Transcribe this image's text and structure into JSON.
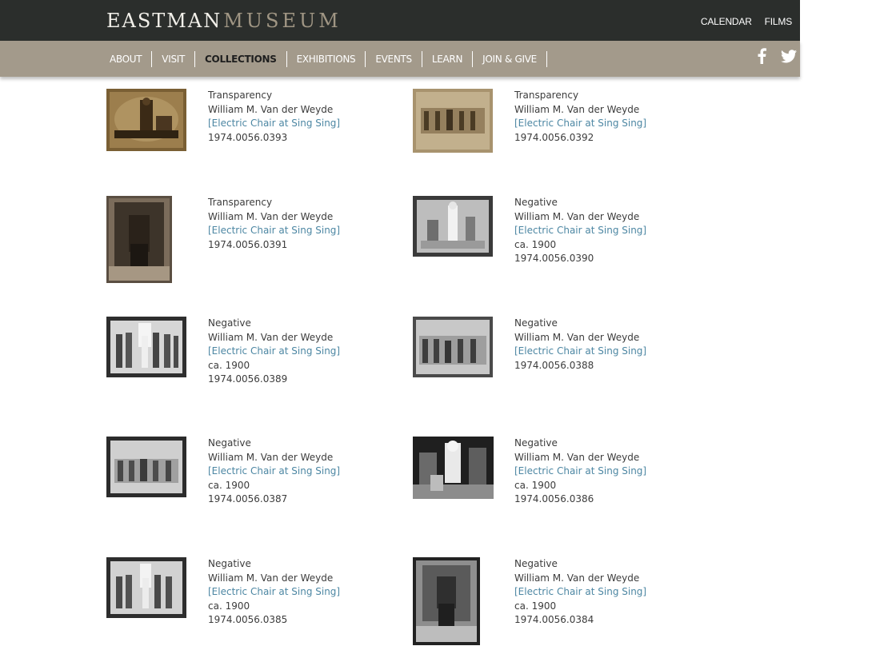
{
  "header": {
    "logo_part1": "EASTMAN",
    "logo_part2": "MUSEUM",
    "utility_links": [
      "CALENDAR",
      "FILMS"
    ]
  },
  "nav": {
    "items": [
      "ABOUT",
      "VISIT",
      "COLLECTIONS",
      "EXHIBITIONS",
      "EVENTS",
      "LEARN",
      "JOIN & GIVE"
    ],
    "active": "COLLECTIONS"
  },
  "social": [
    "facebook-icon",
    "twitter-icon"
  ],
  "colors": {
    "topbar": "#2b2e2c",
    "navbar": "#a39a8b",
    "link": "#4d87a3",
    "text": "#3c3c3c"
  },
  "results": [
    {
      "type": "Transparency",
      "artist": "William M. Van der Weyde",
      "title": "[Electric Chair at Sing Sing]",
      "date": "",
      "accession": "1974.0056.0393"
    },
    {
      "type": "Transparency",
      "artist": "William M. Van der Weyde",
      "title": "[Electric Chair at Sing Sing]",
      "date": "",
      "accession": "1974.0056.0392"
    },
    {
      "type": "Transparency",
      "artist": "William M. Van der Weyde",
      "title": "[Electric Chair at Sing Sing]",
      "date": "",
      "accession": "1974.0056.0391"
    },
    {
      "type": "Negative",
      "artist": "William M. Van der Weyde",
      "title": "[Electric Chair at Sing Sing]",
      "date": "ca. 1900",
      "accession": "1974.0056.0390"
    },
    {
      "type": "Negative",
      "artist": "William M. Van der Weyde",
      "title": "[Electric Chair at Sing Sing]",
      "date": "ca. 1900",
      "accession": "1974.0056.0389"
    },
    {
      "type": "Negative",
      "artist": "William M. Van der Weyde",
      "title": "[Electric Chair at Sing Sing]",
      "date": "",
      "accession": "1974.0056.0388"
    },
    {
      "type": "Negative",
      "artist": "William M. Van der Weyde",
      "title": "[Electric Chair at Sing Sing]",
      "date": "ca. 1900",
      "accession": "1974.0056.0387"
    },
    {
      "type": "Negative",
      "artist": "William M. Van der Weyde",
      "title": "[Electric Chair at Sing Sing]",
      "date": "ca. 1900",
      "accession": "1974.0056.0386"
    },
    {
      "type": "Negative",
      "artist": "William M. Van der Weyde",
      "title": "[Electric Chair at Sing Sing]",
      "date": "ca. 1900",
      "accession": "1974.0056.0385"
    },
    {
      "type": "Negative",
      "artist": "William M. Van der Weyde",
      "title": "[Electric Chair at Sing Sing]",
      "date": "ca. 1900",
      "accession": "1974.0056.0384"
    }
  ]
}
